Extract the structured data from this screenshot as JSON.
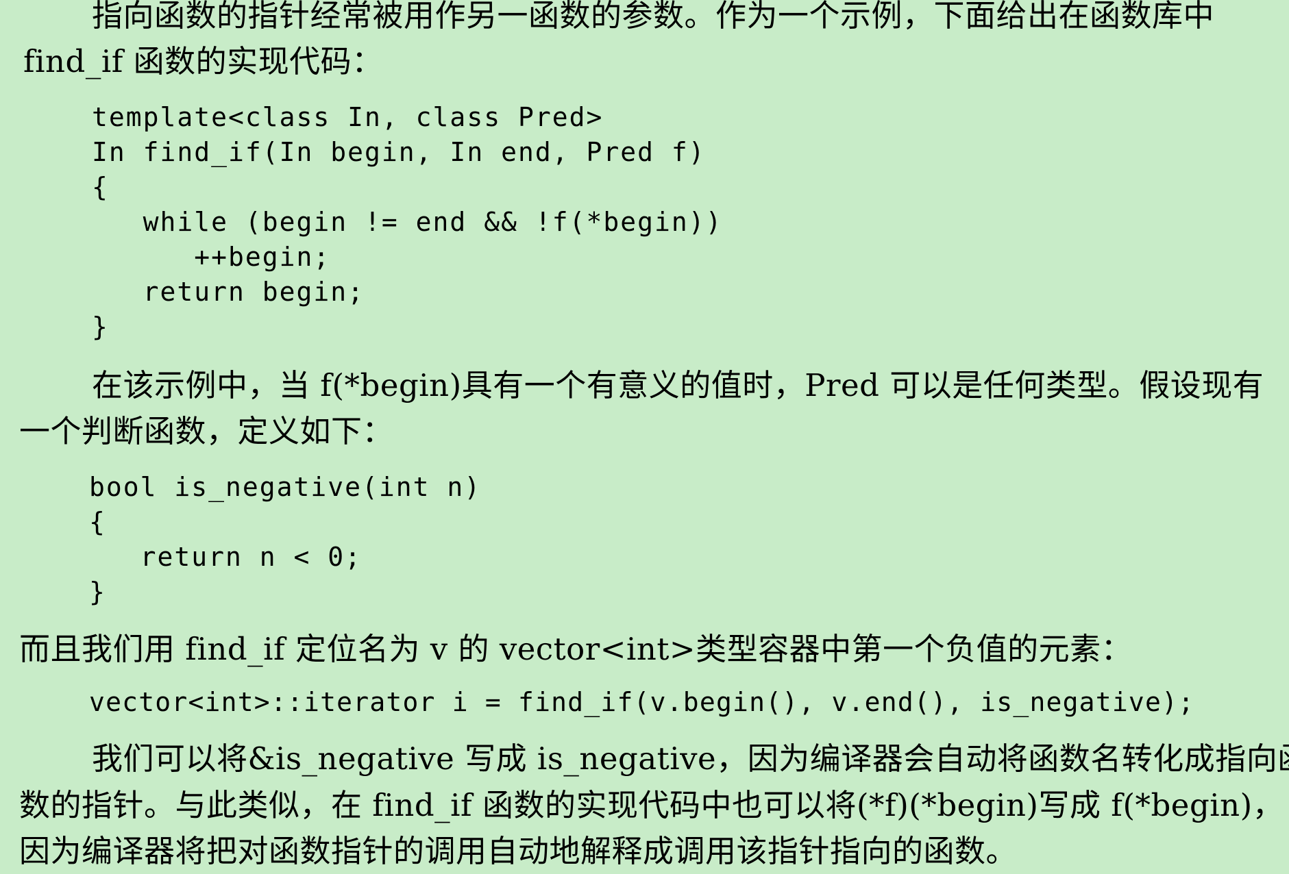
{
  "intro": {
    "line1": "指向函数的指针经常被用作另一函数的参数。作为一个示例，下面给出在函数库中",
    "line2": "find_if 函数的实现代码："
  },
  "code_find_if": [
    "template<class In, class Pred>",
    "In find_if(In begin, In end, Pred f)",
    "{",
    "   while (begin != end && !f(*begin))",
    "      ++begin;",
    "   return begin;",
    "}"
  ],
  "para2": {
    "line1": "在该示例中，当 f(*begin)具有一个有意义的值时，Pred 可以是任何类型。假设现有",
    "line2": "一个判断函数，定义如下："
  },
  "code_is_negative": [
    "bool is_negative(int n)",
    "{",
    "   return n < 0;",
    "}"
  ],
  "para3": {
    "line1": "而且我们用 find_if 定位名为 v 的 vector<int>类型容器中第一个负值的元素："
  },
  "code_call": "vector<int>::iterator i = find_if(v.begin(), v.end(), is_negative);",
  "para4": {
    "line1": "我们可以将&is_negative 写成 is_negative，因为编译器会自动将函数名转化成指向函",
    "line2": "数的指针。与此类似，在 find_if 函数的实现代码中也可以将(*f)(*begin)写成 f(*begin)，",
    "line3": "因为编译器将把对函数指针的调用自动地解释成调用该指针指向的函数。"
  }
}
